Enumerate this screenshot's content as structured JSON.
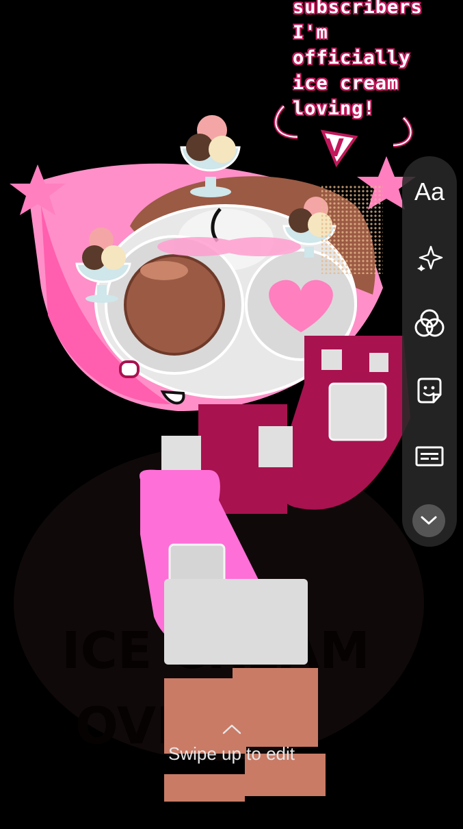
{
  "story": {
    "caption": "subscribers\nI'm\nofficially\nice cream\nloving!",
    "sticker_text": "V",
    "watermark_line1": "ICE CREAM",
    "watermark_line2": "OVING"
  },
  "toolbar": {
    "text_tool_label": "Aa",
    "items": [
      {
        "name": "effects",
        "icon": "sparkle-icon"
      },
      {
        "name": "filters",
        "icon": "color-circles-icon"
      },
      {
        "name": "stickers",
        "icon": "sticker-icon"
      },
      {
        "name": "captions",
        "icon": "captions-icon"
      },
      {
        "name": "collapse",
        "icon": "chevron-down-icon"
      }
    ]
  },
  "hint": {
    "label": "Swipe up to edit",
    "icon": "chevron-up-icon"
  },
  "colors": {
    "background": "#000000",
    "pink_light": "#ff8fc8",
    "pink_hot": "#ff6fd8",
    "magenta": "#a8124f",
    "brown": "#9b5a44",
    "white": "#e8e8e8"
  }
}
